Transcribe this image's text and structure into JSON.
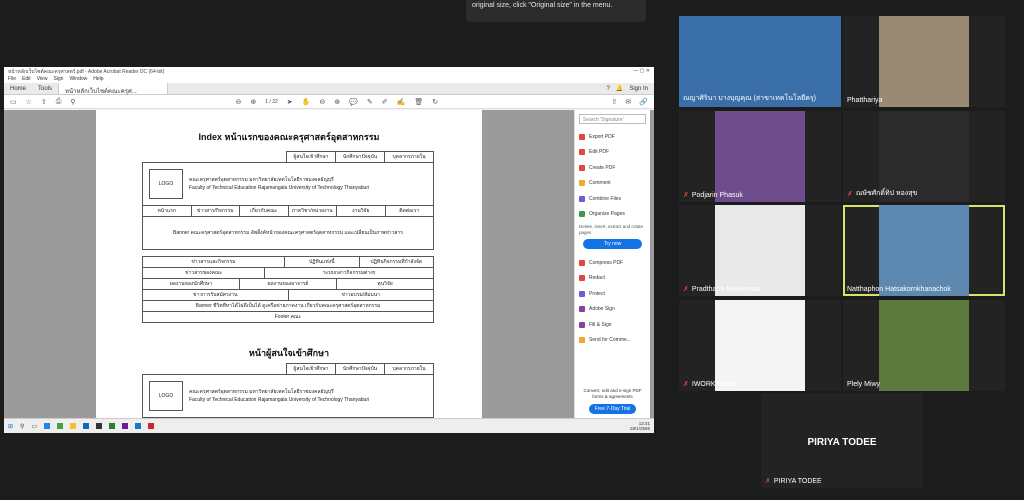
{
  "tooltip": {
    "text": "original size, click \"Original size\" in the menu."
  },
  "acrobat": {
    "window_title": "หน้าหลักเว็บไซต์คณะครุศาสตร์.pdf - Adobe Acrobat Reader DC (64-bit)",
    "menu": [
      "File",
      "Edit",
      "View",
      "Sign",
      "Window",
      "Help"
    ],
    "tabs": {
      "home": "Home",
      "tools": "Tools",
      "document": "หน้าหลักเว็บไซต์คณะครุศ..."
    },
    "sign_in": "Sign In",
    "page_indicator": "1 / 22",
    "page": {
      "title1": "Index หน้าแรกของคณะครุศาสตร์อุตสาหกรรม",
      "title2": "หน้าผู้สนใจเข้าศึกษา",
      "top_links": [
        "ผู้สนใจเข้าศึกษา",
        "นักศึกษาปัจจุบัน",
        "บุคลากรภายใน"
      ],
      "logo": "LOGO",
      "faculty_th": "คณะครุศาสตร์อุตสาหกรรม มหาวิทยาลัยเทคโนโลยีราชมงคลธัญบุรี",
      "faculty_en": "Faculty of Technical Education Rajamangala University of Technology Thanyaburi",
      "nav": [
        "หน้าแรก",
        "ข่าวสาร/กิจกรรม",
        "เกี่ยวกับคณะ",
        "ภาควิชา/หน่วยงาน",
        "งานวิจัย",
        "ติดต่อเรา"
      ],
      "banner": "Banner คณะครุศาสตร์อุตสาหกรรม อัพลิ้งค์หน้าของคณะครุศาสตร์อุตสาหกรรม และเปลี่ยนเป็นภาพข่าวสาร",
      "row1": [
        "ข่าวสารและกิจกรรม",
        "ปฏิทินแห่งนี้",
        "ปฏิทินกิจกรรมที่กำลังจัด"
      ],
      "row2": [
        "ข่าวสารของคณะ",
        "ระบบกล่าวกิจกรรมต่างๆ"
      ],
      "row3": [
        "ผลงานของนักศึกษา",
        "ผลงานของอาจารย์",
        "ทุนวิจัย"
      ],
      "row4": [
        "ข่าวการรับสมัครงาน",
        "ข่าวอบรม/สัมมนา"
      ],
      "row5": "Banner ชีวิตที่หาได้ไม่ดีเป็นได้ ดูเครือข่ายภาคงาน เกี่ยวกับคณะครุศาสตร์อุตสาหกรรม",
      "footer": "Footer คณะ"
    },
    "right_panel": {
      "search_placeholder": "Search 'Signature'",
      "tools": [
        {
          "label": "Export PDF",
          "color": "#e0473e"
        },
        {
          "label": "Edit PDF",
          "color": "#e0473e"
        },
        {
          "label": "Create PDF",
          "color": "#e0473e"
        },
        {
          "label": "Comment",
          "color": "#f0a830"
        },
        {
          "label": "Combine Files",
          "color": "#6b5fd6"
        },
        {
          "label": "Organize Pages",
          "color": "#3e9b4b"
        }
      ],
      "organize_desc": "Delete, insert, extract and rotate pages",
      "try_now": "Try now",
      "tools2": [
        {
          "label": "Compress PDF",
          "color": "#e0473e"
        },
        {
          "label": "Redact",
          "color": "#e0473e"
        },
        {
          "label": "Protect",
          "color": "#6b5fd6"
        },
        {
          "label": "Adobe Sign",
          "color": "#8a3e9e"
        },
        {
          "label": "Fill & Sign",
          "color": "#8a3e9e"
        },
        {
          "label": "Send for Comme...",
          "color": "#f0a830"
        }
      ],
      "promo_text": "Convert, edit and e-sign PDF forms & agreements",
      "promo_button": "Free 7-Day Trial"
    },
    "taskbar": {
      "time": "13:41",
      "date": "28/1/2565"
    }
  },
  "participants": [
    {
      "name": "ณญาศิรินา บางบุญคุณ (สาขาเทคโนโลยีครุ)",
      "bg": "#3a6ea8",
      "mic_off": false
    },
    {
      "name": "Phatthariya",
      "bg": "#9a8a74",
      "mic_off": false
    },
    {
      "name": "Podjarin Phasuk",
      "bg": "#6f4c8c",
      "mic_off": true
    },
    {
      "name": "ณษัชศักดิ์ทิป หองสุข",
      "bg": "#2b2b2b",
      "mic_off": true
    },
    {
      "name": "Pradthana Meekrasae",
      "bg": "#e9e9e9",
      "mic_off": true
    },
    {
      "name": "Natthaphon Hatsakornkhanachok",
      "bg": "#5d88b0",
      "mic_off": false
    },
    {
      "name": "IWORK Rmutt",
      "bg": "#f4f4f4",
      "mic_off": true
    },
    {
      "name": "Plely Miwy",
      "bg": "#5c7a3e",
      "mic_off": false
    }
  ],
  "speaker": {
    "display": "PIRIYA TODEE",
    "name": "PIRIYA TODEE",
    "mic_off": true
  }
}
